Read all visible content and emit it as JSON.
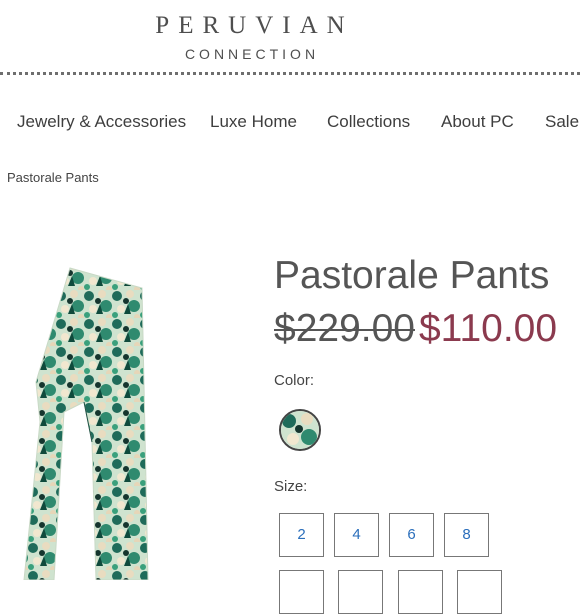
{
  "brand": {
    "name": "PERUVIAN",
    "sub": "CONNECTION"
  },
  "nav": {
    "items": [
      {
        "label": "Jewelry & Accessories"
      },
      {
        "label": "Luxe Home"
      },
      {
        "label": "Collections"
      },
      {
        "label": "About PC"
      },
      {
        "label": "Sale"
      }
    ]
  },
  "breadcrumb": "Pastorale Pants",
  "product": {
    "title": "Pastorale Pants",
    "price_original": "$229.00",
    "price_sale": "$110.00",
    "color_label": "Color:",
    "size_label": "Size:",
    "sizes_row1": [
      "2",
      "4",
      "6",
      "8"
    ],
    "sizes_row2": [
      "",
      "",
      "",
      ""
    ]
  },
  "colors": {
    "sale": "#8b3a4e",
    "size_text": "#2a6ebb",
    "text": "#444444"
  }
}
